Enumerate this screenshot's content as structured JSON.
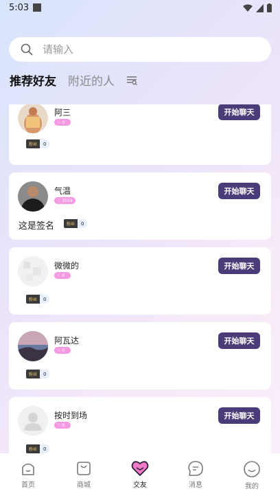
{
  "status_bar": {
    "time": "5:03"
  },
  "search": {
    "placeholder": "请输入"
  },
  "tabs": [
    {
      "label": "推荐好友",
      "active": true
    },
    {
      "label": "附近的人",
      "active": false
    }
  ],
  "users": [
    {
      "name": "阿三",
      "likes": "0",
      "fans_label": "粉丝",
      "fans": "0",
      "signature": "",
      "button": "开始聊天"
    },
    {
      "name": "气温",
      "likes": "3559",
      "fans_label": "粉丝",
      "fans": "0",
      "signature": "这是签名",
      "button": "开始聊天"
    },
    {
      "name": "微微的",
      "likes": "0",
      "fans_label": "粉丝",
      "fans": "0",
      "signature": "",
      "button": "开始聊天"
    },
    {
      "name": "阿瓦达",
      "likes": "0",
      "fans_label": "粉丝",
      "fans": "0",
      "signature": "",
      "button": "开始聊天"
    },
    {
      "name": "按时到场",
      "likes": "0",
      "fans_label": "粉丝",
      "fans": "0",
      "signature": "",
      "button": "开始聊天"
    }
  ],
  "bottom_nav": [
    {
      "label": "首页",
      "icon": "home-icon"
    },
    {
      "label": "商城",
      "icon": "shop-bag-icon"
    },
    {
      "label": "交友",
      "icon": "heart-icon",
      "active": true
    },
    {
      "label": "消息",
      "icon": "message-icon"
    },
    {
      "label": "我的",
      "icon": "profile-smile-icon"
    }
  ],
  "colors": {
    "button": "#4b3b78",
    "like_badge": "#f39ae3",
    "active_heart": "#f07ac5"
  }
}
